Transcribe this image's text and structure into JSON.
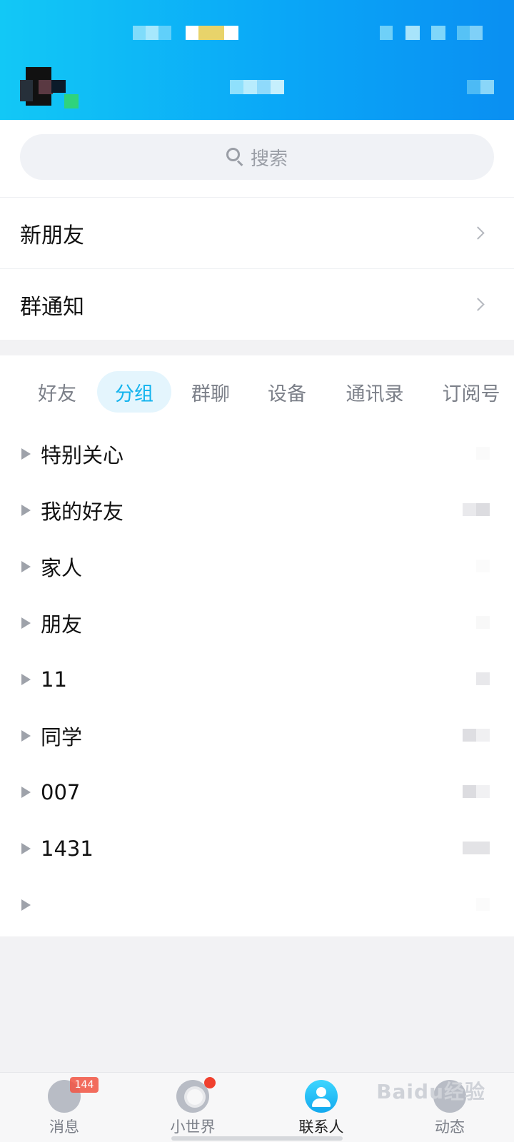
{
  "colors": {
    "header_start": "#12c8f6",
    "header_end": "#0a8ff2",
    "accent": "#12b3ee",
    "badge": "#f25443"
  },
  "search": {
    "placeholder": "搜索",
    "icon": "search-icon"
  },
  "entries": [
    {
      "label": "新朋友",
      "icon": "chevron-right-icon"
    },
    {
      "label": "群通知",
      "icon": "chevron-right-icon"
    }
  ],
  "tabs": [
    {
      "label": "好友",
      "active": false
    },
    {
      "label": "分组",
      "active": true
    },
    {
      "label": "群聊",
      "active": false
    },
    {
      "label": "设备",
      "active": false
    },
    {
      "label": "通讯录",
      "active": false
    },
    {
      "label": "订阅号",
      "active": false
    }
  ],
  "groups": [
    {
      "label": "特别关心"
    },
    {
      "label": "我的好友"
    },
    {
      "label": "家人"
    },
    {
      "label": "朋友"
    },
    {
      "label": "11"
    },
    {
      "label": "同学"
    },
    {
      "label": "007"
    },
    {
      "label": "1431"
    },
    {
      "label": ""
    }
  ],
  "bottom_nav": [
    {
      "label": "消息",
      "icon": "message-icon",
      "badge": "144",
      "active": false
    },
    {
      "label": "小世界",
      "icon": "world-icon",
      "active": false
    },
    {
      "label": "联系人",
      "icon": "contacts-icon",
      "active": true
    },
    {
      "label": "动态",
      "icon": "feed-icon",
      "active": false
    }
  ],
  "watermark": "Baidu经验"
}
